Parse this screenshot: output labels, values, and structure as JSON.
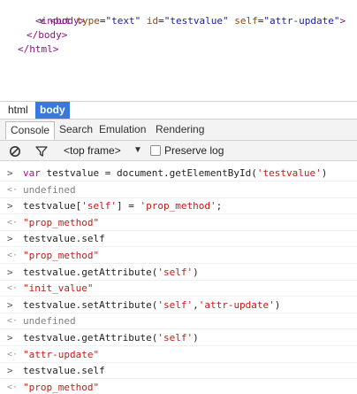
{
  "elements_panel": {
    "lines": [
      {
        "open_body": "<body>"
      },
      {
        "input_tag_open": "<input",
        "attr1_name": "type",
        "attr1_val": "\"text\"",
        "attr2_name": "id",
        "attr2_val": "\"testvalue\"",
        "attr3_name": "self",
        "attr3_val": "\"attr-update\"",
        "close": ">"
      },
      {
        "close_body": "</body>"
      },
      {
        "close_html": "</html>"
      }
    ]
  },
  "breadcrumb": {
    "items": [
      "html",
      "body"
    ]
  },
  "drawer_tabs": [
    "Console",
    "Search",
    "Emulation",
    "Rendering"
  ],
  "toolbar": {
    "frame_label": "<top frame>",
    "frame_arrow": "▼",
    "preserve_log_label": "Preserve log",
    "preserve_log_checked": false
  },
  "console": {
    "entries": [
      {
        "kind": "input",
        "parts": [
          [
            "kw",
            "var"
          ],
          [
            "plain",
            " testvalue = document.getElementById("
          ],
          [
            "str",
            "'testvalue'"
          ],
          [
            "plain",
            ")"
          ]
        ]
      },
      {
        "kind": "output",
        "parts": [
          [
            "undef",
            "undefined"
          ]
        ]
      },
      {
        "kind": "input",
        "parts": [
          [
            "plain",
            "testvalue["
          ],
          [
            "str",
            "'self'"
          ],
          [
            "plain",
            "] = "
          ],
          [
            "str",
            "'prop_method'"
          ],
          [
            "plain",
            ";"
          ]
        ]
      },
      {
        "kind": "output",
        "parts": [
          [
            "result-str",
            "\"prop_method\""
          ]
        ]
      },
      {
        "kind": "input",
        "parts": [
          [
            "plain",
            "testvalue.self"
          ]
        ]
      },
      {
        "kind": "output",
        "parts": [
          [
            "result-str",
            "\"prop_method\""
          ]
        ]
      },
      {
        "kind": "input",
        "parts": [
          [
            "plain",
            "testvalue.getAttribute("
          ],
          [
            "str",
            "'self'"
          ],
          [
            "plain",
            ")"
          ]
        ]
      },
      {
        "kind": "output",
        "parts": [
          [
            "result-str",
            "\"init_value\""
          ]
        ]
      },
      {
        "kind": "input",
        "parts": [
          [
            "plain",
            "testvalue.setAttribute("
          ],
          [
            "str",
            "'self'"
          ],
          [
            "plain",
            ","
          ],
          [
            "str",
            "'attr-update'"
          ],
          [
            "plain",
            ")"
          ]
        ]
      },
      {
        "kind": "output",
        "parts": [
          [
            "undef",
            "undefined"
          ]
        ]
      },
      {
        "kind": "input",
        "parts": [
          [
            "plain",
            "testvalue.getAttribute("
          ],
          [
            "str",
            "'self'"
          ],
          [
            "plain",
            ")"
          ]
        ]
      },
      {
        "kind": "output",
        "parts": [
          [
            "result-str",
            "\"attr-update\""
          ]
        ]
      },
      {
        "kind": "input",
        "parts": [
          [
            "plain",
            "testvalue.self"
          ]
        ]
      },
      {
        "kind": "output",
        "parts": [
          [
            "result-str",
            "\"prop_method\""
          ]
        ]
      }
    ]
  },
  "colors": {
    "tag": "#881280",
    "attr_name": "#994500",
    "attr_value": "#1a1aa6",
    "string": "#c41a16",
    "keyword": "#aa0d91",
    "selected_crumb": "#3879d9"
  },
  "icons": {
    "clear": "clear-console-icon",
    "filter": "filter-icon",
    "input_prompt": "chevron-right-icon",
    "output_prompt": "left-arrow-icon"
  }
}
